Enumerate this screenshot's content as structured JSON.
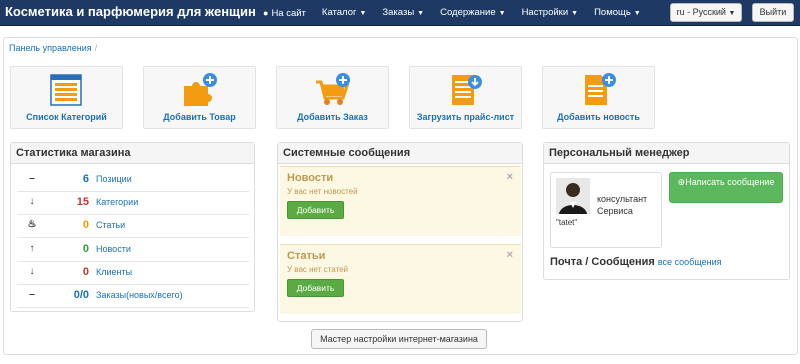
{
  "navbar": {
    "brand": "Косметика и парфюмерия для женщин",
    "items": [
      {
        "label": "На сайт",
        "icon": "globe-icon"
      },
      {
        "label": "Каталог",
        "caret": true
      },
      {
        "label": "Заказы",
        "caret": true
      },
      {
        "label": "Содержание",
        "caret": true
      },
      {
        "label": "Настройки",
        "caret": true
      },
      {
        "label": "Помощь",
        "caret": true
      }
    ],
    "language": "ru - Русский",
    "logout": "Выйти"
  },
  "breadcrumb": {
    "label": "Панель управления",
    "sep": "/"
  },
  "tiles": [
    {
      "label": "Список Категорий",
      "icon": "category-list-icon"
    },
    {
      "label": "Добавить Товар",
      "icon": "add-product-icon"
    },
    {
      "label": "Добавить Заказ",
      "icon": "add-order-cart-icon"
    },
    {
      "label": "Загрузить прайс-лист",
      "icon": "upload-pricelist-icon"
    },
    {
      "label": "Добавить новость",
      "icon": "add-news-icon"
    }
  ],
  "stats": {
    "title": "Статистика магазина",
    "rows": [
      {
        "arrow": "–",
        "value": "6",
        "label": "Позиции",
        "color": "#1a70b8"
      },
      {
        "arrow": "↓",
        "value": "15",
        "label": "Категории",
        "color": "#c0392b"
      },
      {
        "arrow": "♨",
        "value": "0",
        "label": "Статьи",
        "color": "#e6a200"
      },
      {
        "arrow": "↑",
        "value": "0",
        "label": "Новости",
        "color": "#3c9a3c"
      },
      {
        "arrow": "↓",
        "value": "0",
        "label": "Клиенты",
        "color": "#c0392b"
      },
      {
        "arrow": "–",
        "value": "0/0",
        "label": "Заказы(новых/всего)",
        "color": "#1a70b8"
      }
    ]
  },
  "system": {
    "title": "Системные сообщения",
    "messages": [
      {
        "title": "Новости",
        "text": "У вас нет новостей",
        "button": "Добавить",
        "close": "×"
      },
      {
        "title": "Статьи",
        "text": "У вас нет статей",
        "button": "Добавить",
        "close": "×"
      }
    ]
  },
  "manager": {
    "title": "Персональный менеджер",
    "role": "консультант Сервиса",
    "name": "\"tatet\"",
    "write_button": "Написать сообщение",
    "mail_title": "Почта / Сообщения",
    "mail_link": "все сообщения"
  },
  "wizard_button": "Мастер настройки интернет-магазина"
}
